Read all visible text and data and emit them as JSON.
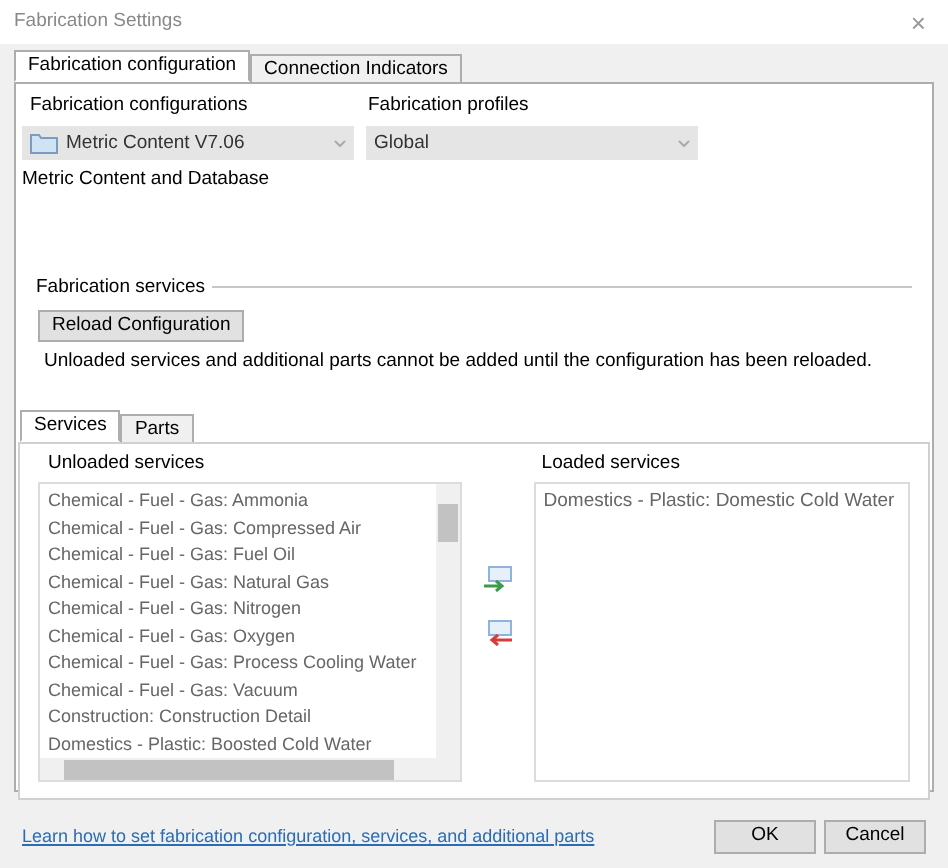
{
  "window": {
    "title": "Fabrication Settings",
    "close": "×"
  },
  "tabs": [
    {
      "label": "Fabrication configuration",
      "selected": true
    },
    {
      "label": "Connection Indicators",
      "selected": false
    }
  ],
  "configurations": {
    "label": "Fabrication configurations",
    "value": "Metric Content V7.06",
    "description": "Metric Content and Database"
  },
  "profiles": {
    "label": "Fabrication profiles",
    "value": "Global"
  },
  "services_group": {
    "title": "Fabrication services",
    "button": "Reload Configuration",
    "note": "Unloaded services and additional parts cannot be added until the configuration has been reloaded."
  },
  "sub_tabs": [
    {
      "label": "Services",
      "selected": true
    },
    {
      "label": "Parts",
      "selected": false
    }
  ],
  "unloaded": {
    "label": "Unloaded services",
    "items": [
      "Chemical - Fuel - Gas: Ammonia",
      "Chemical - Fuel - Gas: Compressed Air",
      "Chemical - Fuel - Gas: Fuel Oil",
      "Chemical - Fuel - Gas: Natural Gas",
      "Chemical - Fuel - Gas: Nitrogen",
      "Chemical - Fuel - Gas: Oxygen",
      "Chemical - Fuel - Gas: Process Cooling Water",
      "Chemical - Fuel - Gas: Vacuum",
      "Construction: Construction Detail",
      "Domestics - Plastic: Boosted Cold Water"
    ]
  },
  "loaded": {
    "label": "Loaded services",
    "items": [
      "Domestics - Plastic: Domestic Cold Water"
    ]
  },
  "footer": {
    "link": "Learn how to set fabrication configuration, services, and additional parts",
    "buttons": [
      "OK",
      "Cancel"
    ]
  }
}
